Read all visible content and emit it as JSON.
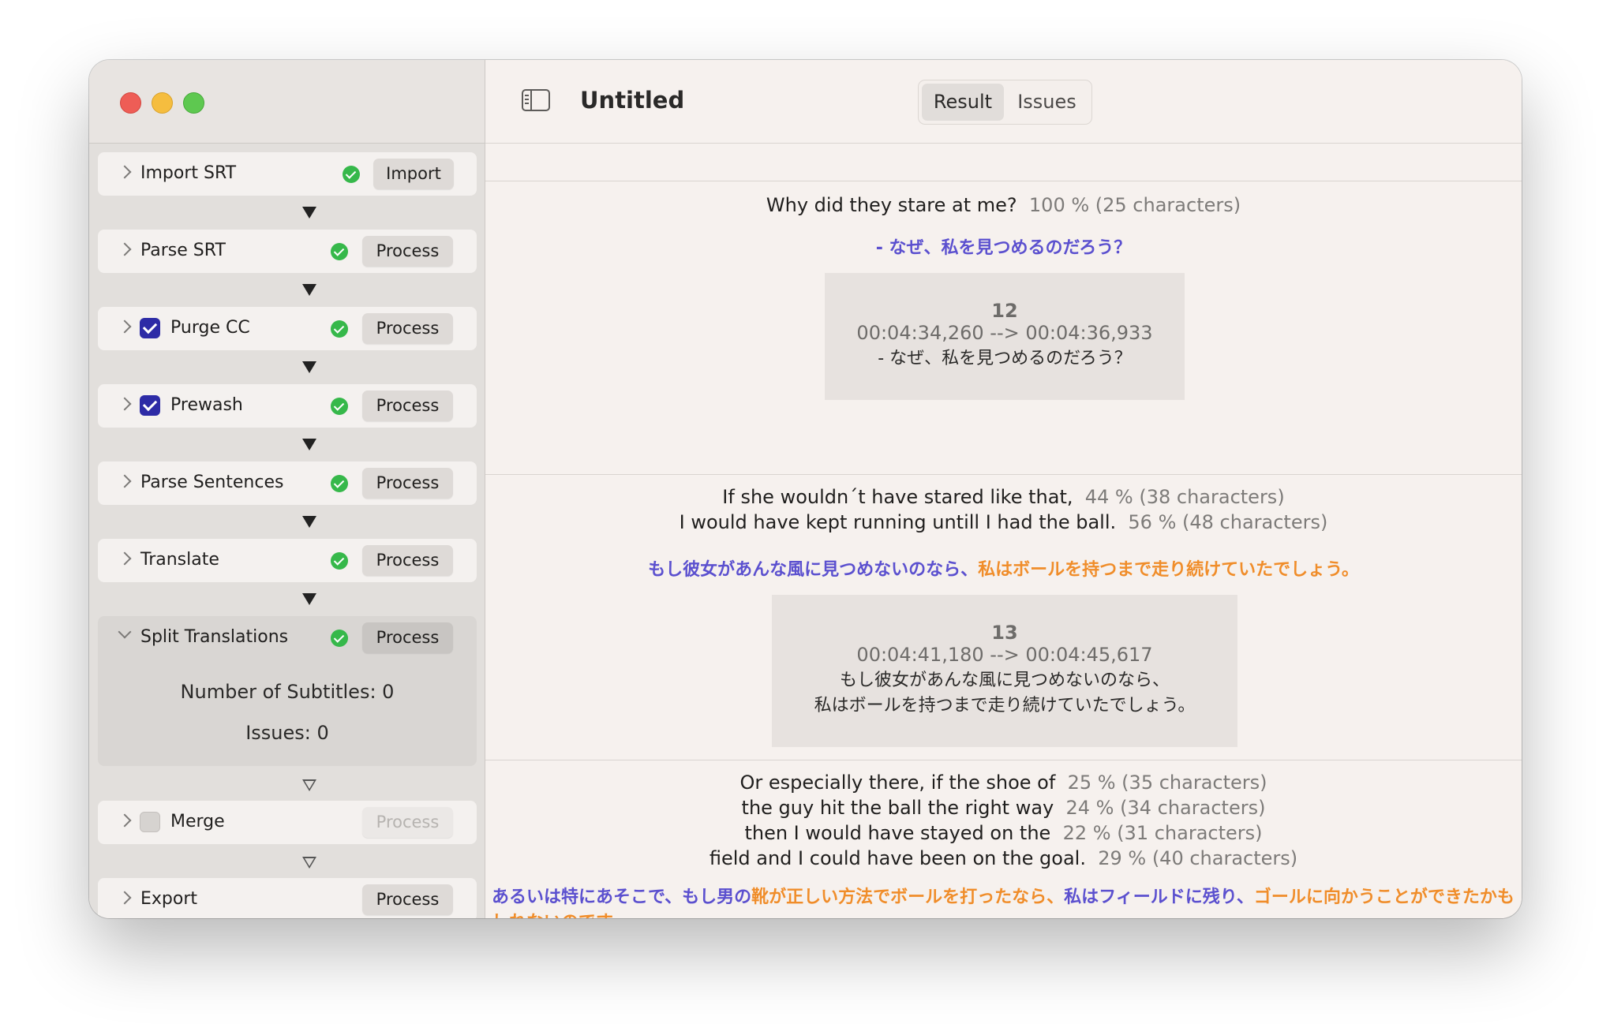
{
  "window": {
    "title": "Untitled"
  },
  "tabs": [
    {
      "label": "Result",
      "active": true
    },
    {
      "label": "Issues",
      "active": false
    }
  ],
  "steps": [
    {
      "label": "Import SRT",
      "checkbox": null,
      "status": "ok",
      "button": "Import",
      "expanded": false
    },
    {
      "label": "Parse SRT",
      "checkbox": null,
      "status": "ok",
      "button": "Process",
      "expanded": false
    },
    {
      "label": "Purge CC",
      "checkbox": true,
      "status": "ok",
      "button": "Process",
      "expanded": false
    },
    {
      "label": "Prewash",
      "checkbox": true,
      "status": "ok",
      "button": "Process",
      "expanded": false
    },
    {
      "label": "Parse Sentences",
      "checkbox": null,
      "status": "ok",
      "button": "Process",
      "expanded": false
    },
    {
      "label": "Translate",
      "checkbox": null,
      "status": "ok",
      "button": "Process",
      "expanded": false
    },
    {
      "label": "Split Translations",
      "checkbox": null,
      "status": "ok",
      "button": "Process",
      "expanded": true
    },
    {
      "label": "Merge",
      "checkbox": false,
      "status": null,
      "button": "Process",
      "expanded": false,
      "disabled": true
    },
    {
      "label": "Export",
      "checkbox": null,
      "status": null,
      "button": "Process",
      "expanded": false
    }
  ],
  "split_details": {
    "subtitles": "Number of Subtitles: 0",
    "issues": "Issues: 0"
  },
  "entries": [
    {
      "lines": [
        {
          "text": "Why did they stare at me?",
          "pct": "100 % (25 characters)"
        }
      ],
      "translation": [
        {
          "text": "- なぜ、私を見つめるのだろう？",
          "color": "purple"
        }
      ],
      "card": {
        "number": "12",
        "time": "00:04:34,260 --> 00:04:36,933",
        "text": [
          "- なぜ、私を見つめるのだろう？"
        ]
      }
    },
    {
      "lines": [
        {
          "text": "If she wouldn´t have stared like that,",
          "pct": "44 % (38 characters)"
        },
        {
          "text": "I would have kept running untill I had the ball.",
          "pct": "56 % (48 characters)"
        }
      ],
      "translation": [
        {
          "text": "もし彼女があんな風に見つめないのなら、",
          "color": "purple"
        },
        {
          "text": "私はボールを持つまで走り続けていたでしょう。",
          "color": "orange"
        }
      ],
      "card": {
        "number": "13",
        "time": "00:04:41,180 --> 00:04:45,617",
        "text": [
          "もし彼女があんな風に見つめないのなら、",
          "私はボールを持つまで走り続けていたでしょう。"
        ]
      }
    },
    {
      "lines": [
        {
          "text": "Or especially there, if the shoe of",
          "pct": "25 % (35 characters)"
        },
        {
          "text": "the guy hit the ball the right way",
          "pct": "24 % (34 characters)"
        },
        {
          "text": "then I would have stayed on the",
          "pct": "22 % (31 characters)"
        },
        {
          "text": "field and I could have been on the goal.",
          "pct": "29 % (40 characters)"
        }
      ],
      "translation": [
        {
          "text": "あるいは特にあそこで、もし男の",
          "color": "purple"
        },
        {
          "text": "靴が正しい方法でボールを打ったなら、",
          "color": "orange"
        },
        {
          "text": "私はフィールドに残り、",
          "color": "purple"
        },
        {
          "text": "ゴールに向かうことができたかもしれないのです。",
          "color": "orange"
        }
      ]
    }
  ],
  "colors": {
    "purple": "#5b50cf",
    "orange": "#f08d2a",
    "check_green": "#36b84a",
    "checkbox_blue": "#2d2ba6"
  }
}
